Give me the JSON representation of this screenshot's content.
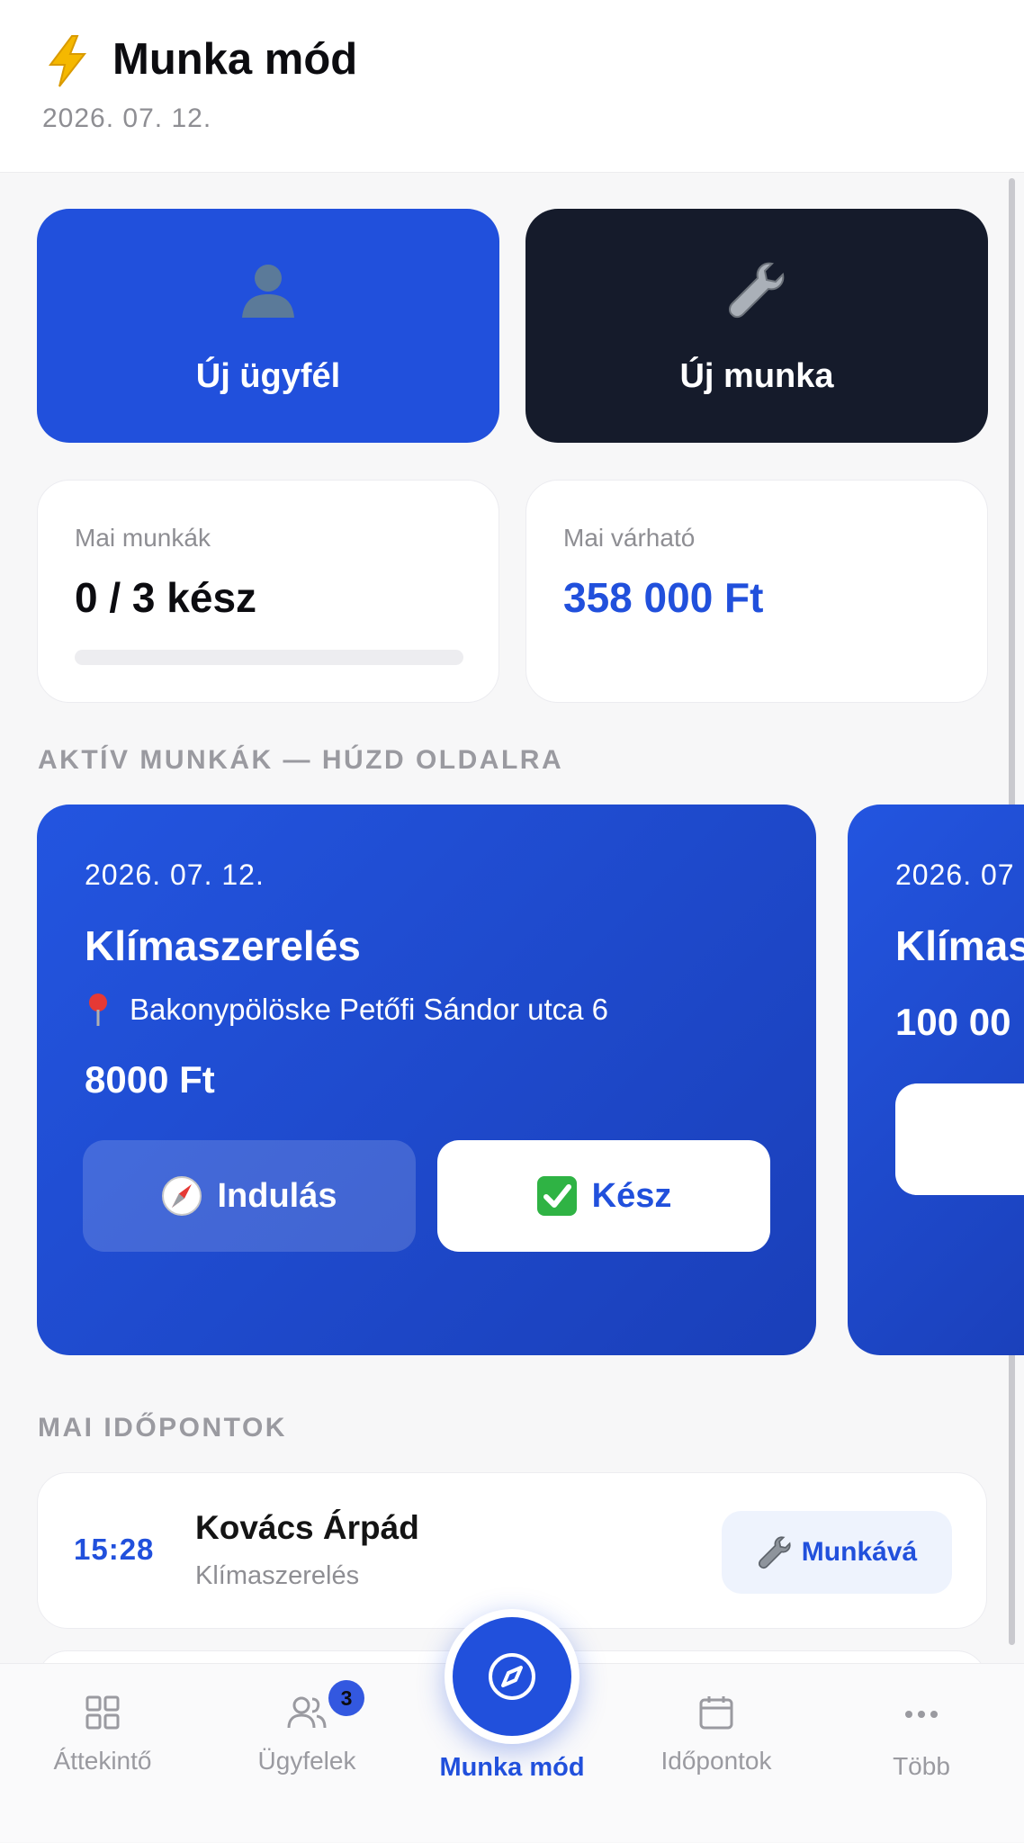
{
  "header": {
    "title": "Munka mód",
    "date": "2026. 07. 12.",
    "icon": "lightning-icon"
  },
  "quick_actions": [
    {
      "label": "Új ügyfél",
      "icon": "person-icon",
      "color": "#2150dc"
    },
    {
      "label": "Új munka",
      "icon": "wrench-icon",
      "color": "#151b2b"
    }
  ],
  "stats": {
    "jobs_label": "Mai munkák",
    "jobs_value": "0 / 3 kész",
    "jobs_progress": 0,
    "expected_label": "Mai várható",
    "expected_value": "358 000 Ft"
  },
  "active_section_title": "AKTÍV MUNKÁK — HÚZD OLDALRA",
  "active_jobs": [
    {
      "date": "2026. 07. 12.",
      "title": "Klímaszerelés",
      "address": "Bakonypölöske Petőfi Sándor utca 6",
      "price": "8000 Ft",
      "go_label": "Indulás",
      "done_label": "Kész"
    },
    {
      "date": "2026. 07",
      "title": "Klímas",
      "price": "100 00"
    }
  ],
  "appointments_section_title": "MAI IDŐPONTOK",
  "appointments": [
    {
      "time": "15:28",
      "name": "Kovács Árpád",
      "service": "Klímaszerelés",
      "action_label": "Munkává"
    }
  ],
  "tabbar": {
    "items": [
      {
        "label": "Áttekintő",
        "icon": "grid-icon"
      },
      {
        "label": "Ügyfelek",
        "icon": "users-icon",
        "badge": "3"
      },
      {
        "label": "Munka mód",
        "icon": "compass-icon",
        "active": true
      },
      {
        "label": "Időpontok",
        "icon": "calendar-icon"
      },
      {
        "label": "Több",
        "icon": "more-icon"
      }
    ]
  },
  "colors": {
    "accent": "#2150dc",
    "dark": "#151b2b",
    "muted": "#8e8e93"
  }
}
